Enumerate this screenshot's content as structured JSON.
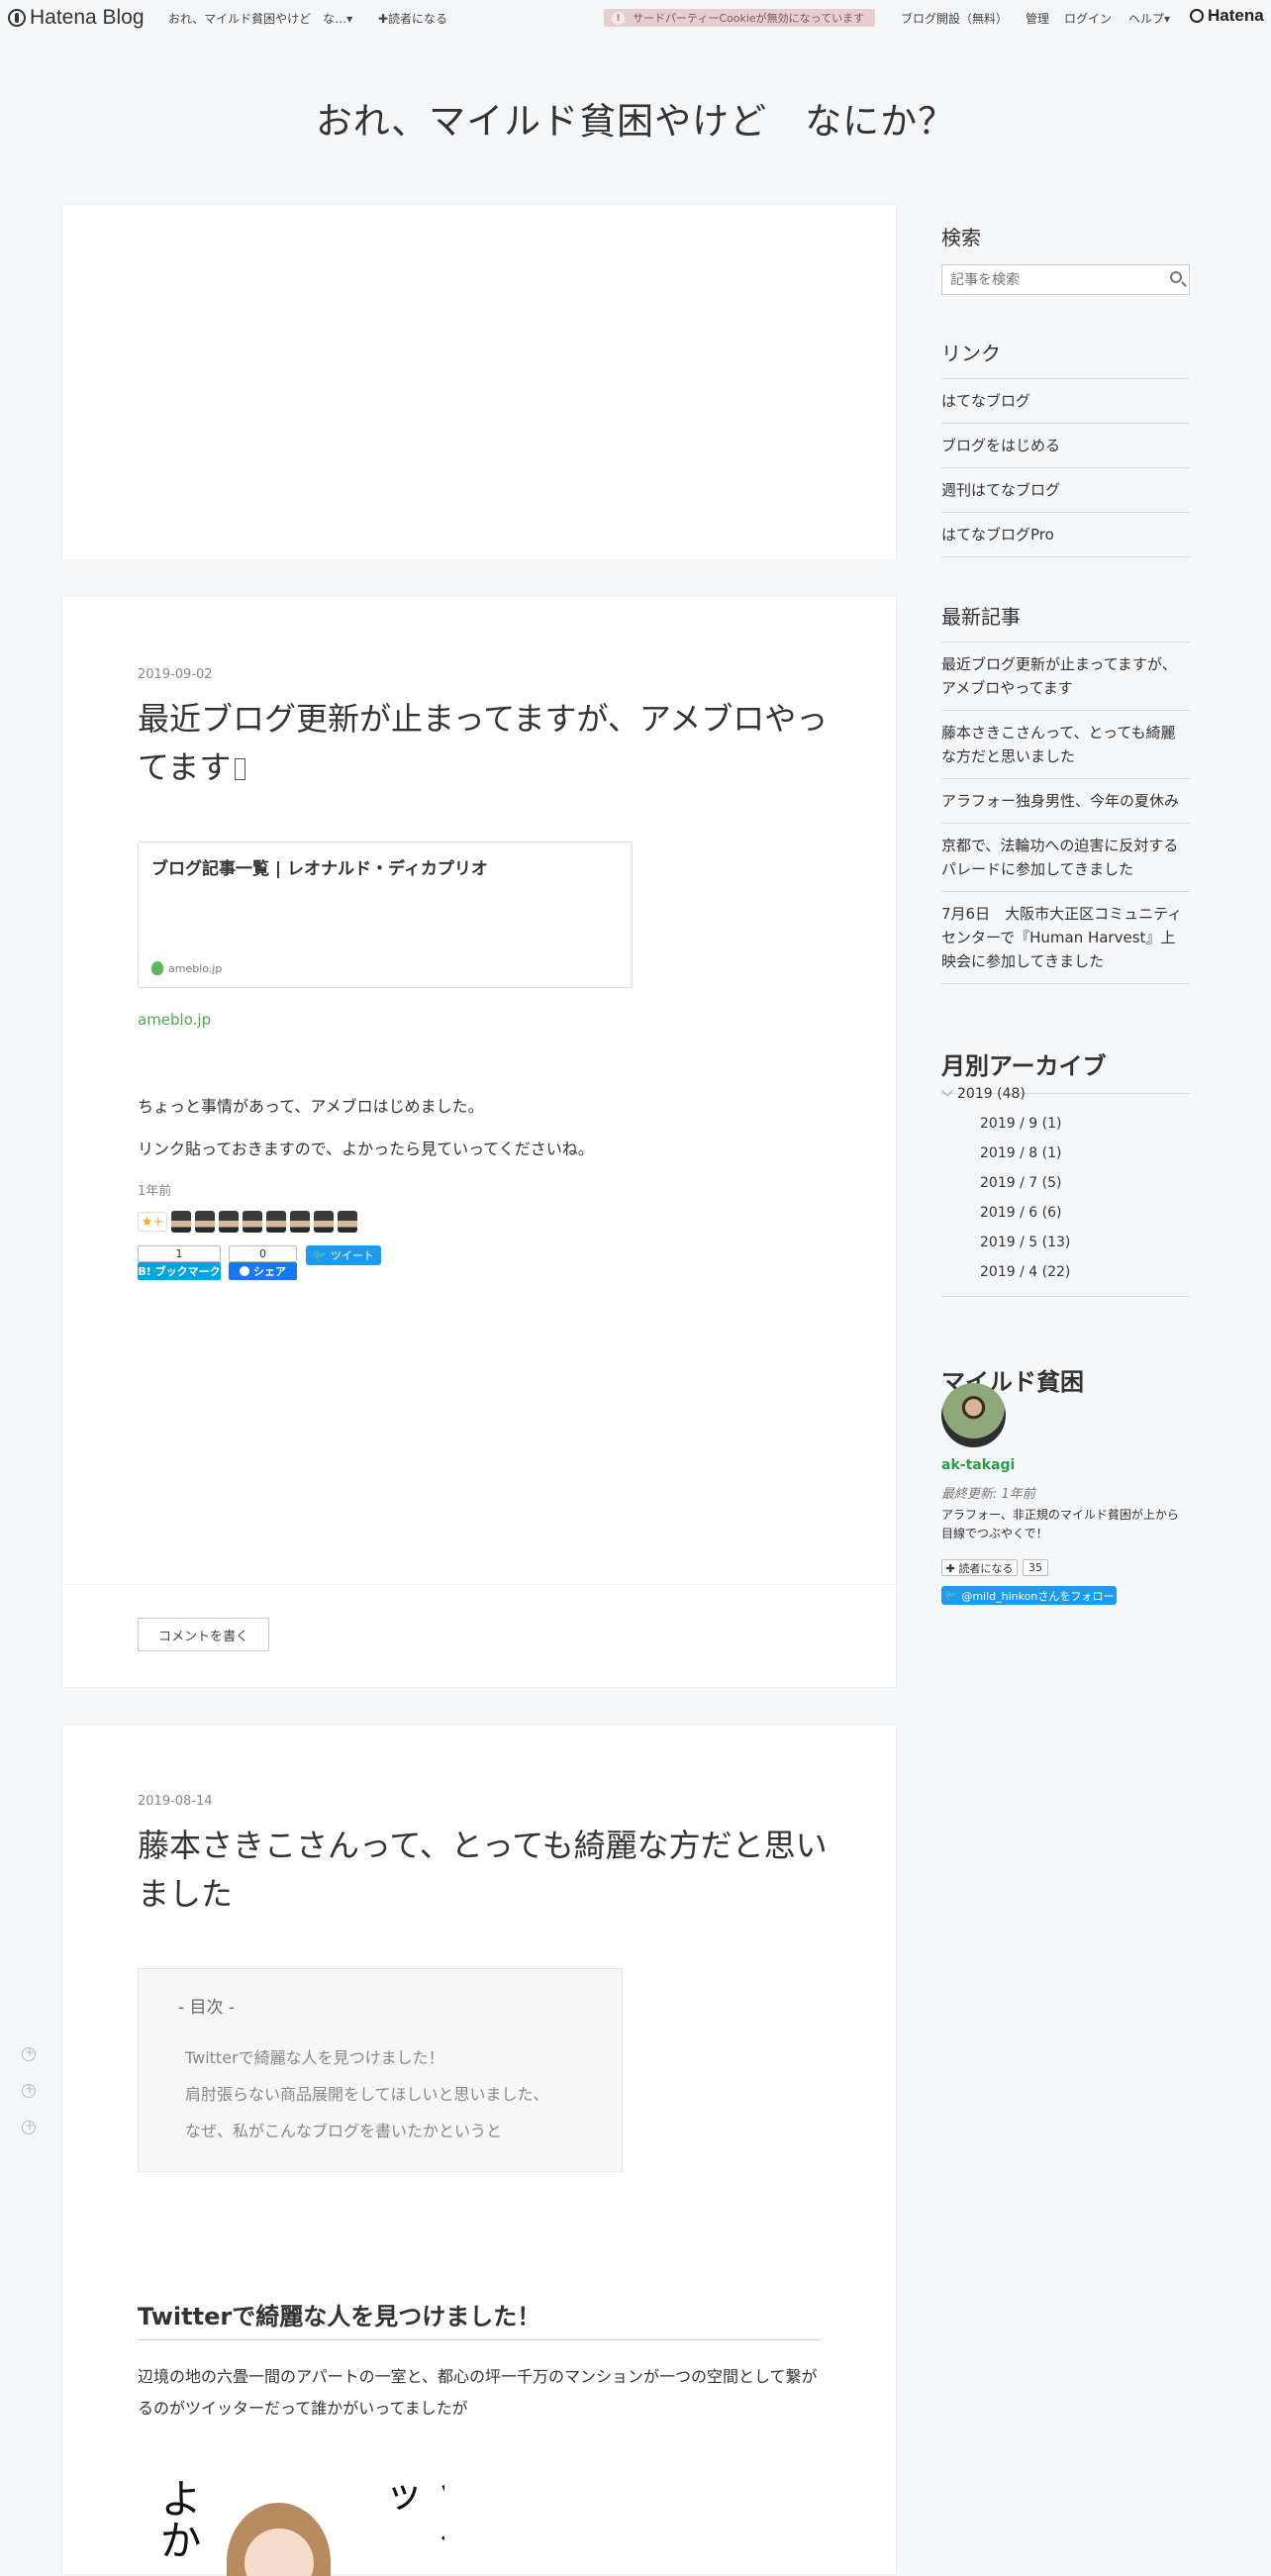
{
  "topbar": {
    "logo": "Hatena Blog",
    "blog_name": "おれ、マイルド貧困やけど　な…▾",
    "reader": "✚読者になる",
    "cookie_warning": "サードパーティーCookieが無効になっています",
    "links": [
      "ブログ開設（無料）",
      "管理",
      "ログイン",
      "ヘルプ▾"
    ],
    "hatena": "Hatena"
  },
  "blog_title": "おれ、マイルド貧困やけど　なにか？",
  "post1": {
    "date": "2019-09-02",
    "title": "最近ブログ更新が止まってますが、アメブロやってます",
    "embed_title": "ブログ記事一覧 | レオナルド・ディカプリオ",
    "embed_domain": "ameblo.jp",
    "link": "ameblo.jp",
    "text1": "ちょっと事情があって、アメブロはじめました。",
    "text2": "リンク貼っておきますので、よかったら見ていってくださいね。",
    "ago": "1年前",
    "star_add": "★+",
    "bookmark_count": "1",
    "bookmark_label": "B! ブックマーク",
    "fb_count": "0",
    "fb_label": "シェア",
    "tweet_label": "ツイート",
    "comment_button": "コメントを書く"
  },
  "post2": {
    "date": "2019-08-14",
    "title": "藤本さきこさんって、とっても綺麗な方だと思いました",
    "toc_title": "- 目次 -",
    "toc_items": [
      "Twitterで綺麗な人を見つけました！",
      "肩肘張らない商品展開をしてほしいと思いました、",
      "なぜ、私がこんなブログを書いたかというと"
    ],
    "heading": "Twitterで綺麗な人を見つけました！",
    "body": "辺境の地の六畳一間のアパートの一室と、都心の坪一千万のマンションが一つの空間として繋がるのがツイッターだって誰かがいってましたが",
    "manga_text_left": "よか",
    "manga_text_right": "ツイッ"
  },
  "sidebar": {
    "search_title": "検索",
    "search_placeholder": "記事を検索",
    "links_title": "リンク",
    "links": [
      "はてなブログ",
      "ブログをはじめる",
      "週刊はてなブログ",
      "はてなブログPro"
    ],
    "recent_title": "最新記事",
    "recent": [
      "最近ブログ更新が止まってますが、アメブロやってます",
      "藤本さきこさんって、とっても綺麗な方だと思いました",
      "アラフォー独身男性、今年の夏休み",
      "京都で、法輪功への迫害に反対するパレードに参加してきました",
      "7月6日　大阪市大正区コミュニティセンターで『Human Harvest』上映会に参加してきました"
    ],
    "archive_title": "月別アーカイブ",
    "archive_year": "2019 (48)",
    "archive_months": [
      "2019 / 9 (1)",
      "2019 / 8 (1)",
      "2019 / 7 (5)",
      "2019 / 6 (6)",
      "2019 / 5 (13)",
      "2019 / 4 (22)"
    ],
    "profile_title": "マイルド貧困",
    "profile_id": "ak-takagi",
    "profile_updated": "最終更新: 1年前",
    "profile_desc": "アラフォー、非正規のマイルド貧困が上から目線でつぶやくで！",
    "reader_button": "✚ 読者になる",
    "reader_count": "35",
    "twitter_follow": "@mild_hinkonさんをフォロー"
  }
}
